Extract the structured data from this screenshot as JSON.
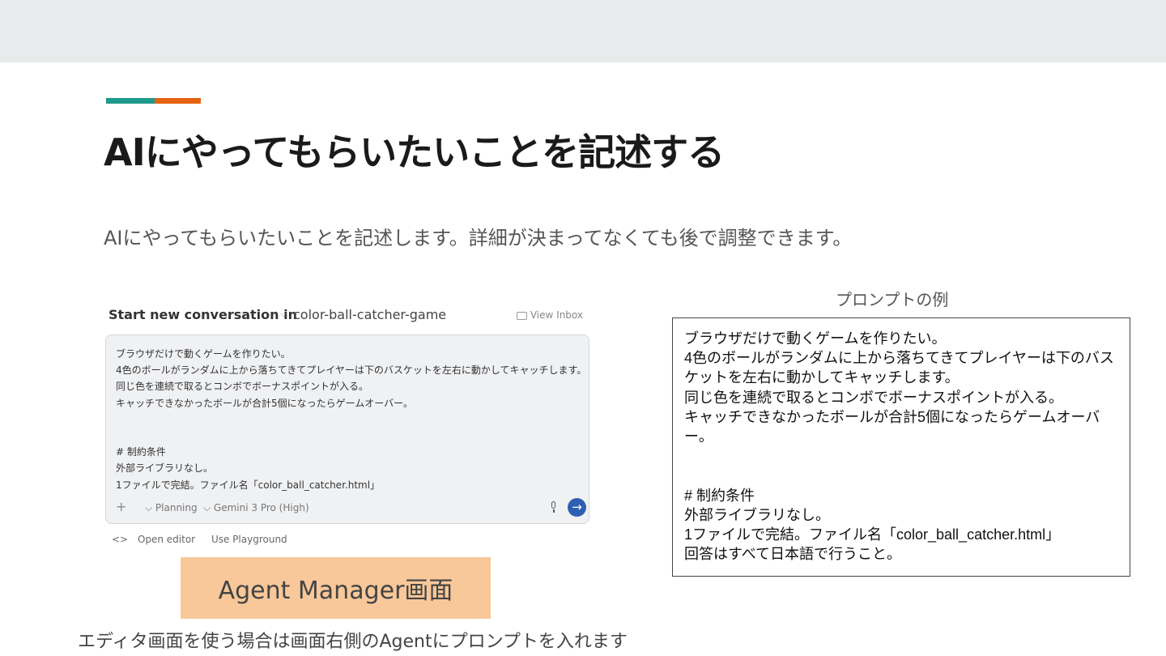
{
  "colors": {
    "accent_teal": "#1f9a8a",
    "accent_orange": "#e5620f",
    "send_button": "#2f5fb3",
    "agent_label_bg": "#f8c89a"
  },
  "slide": {
    "title": "AIにやってもらいたいことを記述する",
    "subtitle": "AIにやってもらいたいことを記述します。詳細が決まってなくても後で調整できます。"
  },
  "screenshot": {
    "header_title": "Start new conversation in",
    "repo_name": "color-ball-catcher-game",
    "view_inbox": "View Inbox",
    "prompt_lines": "ブラウザだけで動くゲームを作りたい。\n4色のボールがランダムに上から落ちてきてプレイヤーは下のバスケットを左右に動かしてキャッチします。\n同じ色を連続で取るとコンボでボーナスポイントが入る。\nキャッチできなかったボールが合計5個になったらゲームオーバー。\n\n\n# 制約条件\n外部ライブラリなし。\n1ファイルで完結。ファイル名「color_ball_catcher.html」",
    "footer": {
      "plus": "+",
      "mode": "Planning",
      "model": "Gemini 3 Pro (High)"
    },
    "links": {
      "open_editor": "Open editor",
      "use_playground": "Use Playground"
    }
  },
  "agent_label": "Agent Manager画面",
  "bottom_caption": "エディタ画面を使う場合は画面右側のAgentにプロンプトを入れます",
  "example": {
    "heading": "プロンプトの例",
    "text": "ブラウザだけで動くゲームを作りたい。\n4色のボールがランダムに上から落ちてきてプレイヤーは下のバスケットを左右に動かしてキャッチします。\n同じ色を連続で取るとコンボでボーナスポイントが入る。\nキャッチできなかったボールが合計5個になったらゲームオーバー。\n\n\n# 制約条件\n外部ライブラリなし。\n1ファイルで完結。ファイル名「color_ball_catcher.html」\n回答はすべて日本語で行うこと。"
  }
}
